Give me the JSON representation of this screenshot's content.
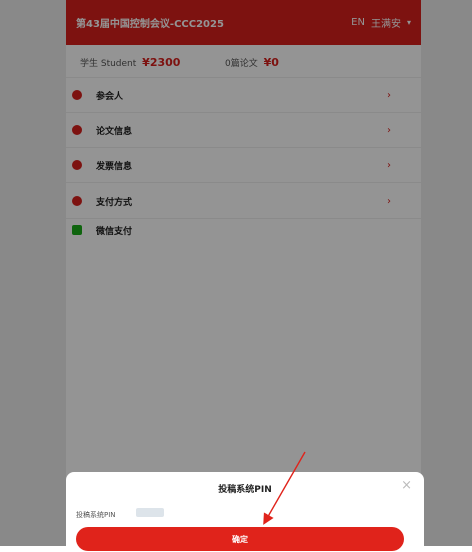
{
  "header": {
    "title": "第43届中国控制会议-CCC2025",
    "lang": "EN",
    "user": "王满安",
    "caret": "▾"
  },
  "fees": {
    "student_label": "学生 Student",
    "student_price": "¥2300",
    "paper_label": "0篇论文",
    "paper_price": "¥0"
  },
  "menu": [
    {
      "label": "参会人",
      "chevron": "›"
    },
    {
      "label": "论文信息",
      "chevron": "›"
    },
    {
      "label": "发票信息",
      "chevron": "›"
    },
    {
      "label": "支付方式",
      "chevron": "›"
    }
  ],
  "payment": {
    "wechat_label": "微信支付"
  },
  "dialog": {
    "title": "投稿系统PIN",
    "close": "×",
    "pin_label": "投稿系统PIN",
    "confirm_label": "确定"
  },
  "colors": {
    "brand_red": "#d7201d",
    "wechat_green": "#1aad19",
    "overlay": "rgba(0,0,0,0.42)"
  }
}
